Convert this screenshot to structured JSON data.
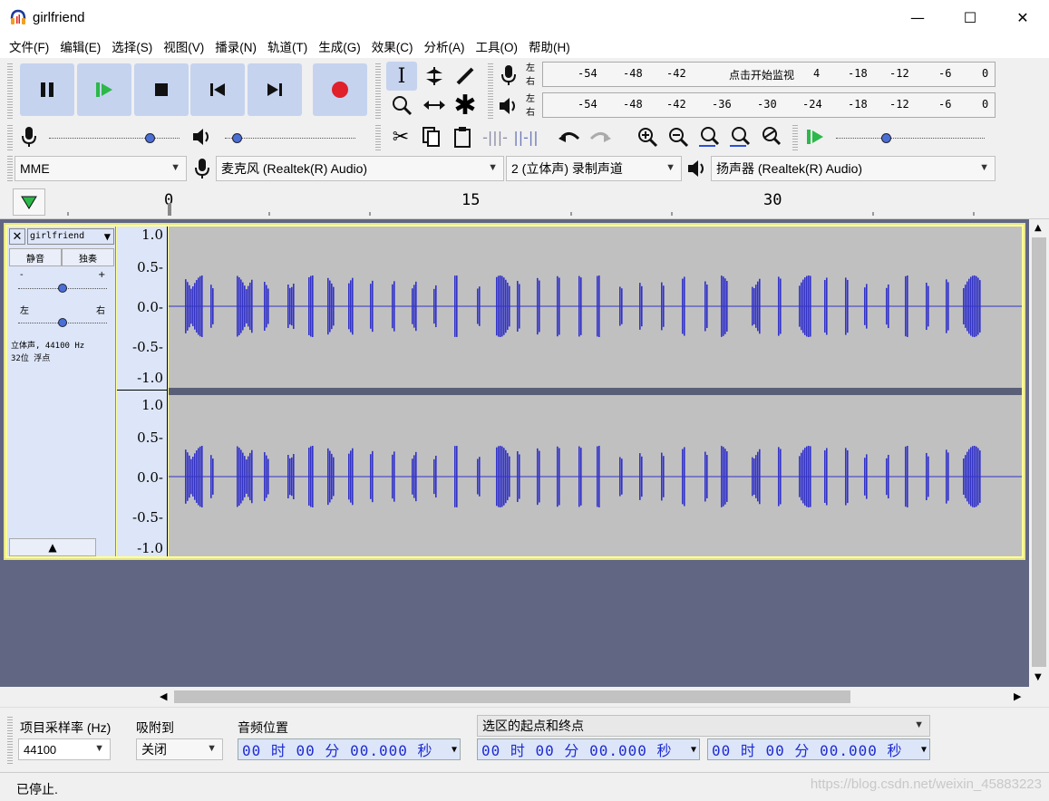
{
  "window": {
    "title": "girlfriend",
    "minimize": "—",
    "maximize": "☐",
    "close": "✕"
  },
  "menu": [
    "文件(F)",
    "编辑(E)",
    "选择(S)",
    "视图(V)",
    "播录(N)",
    "轨道(T)",
    "生成(G)",
    "效果(C)",
    "分析(A)",
    "工具(O)",
    "帮助(H)"
  ],
  "meters": {
    "left_right": [
      "左",
      "右"
    ],
    "record_scale": [
      "-54",
      "-48",
      "-42",
      "点击开始监视",
      "4",
      "-18",
      "-12",
      "-6",
      "0"
    ],
    "play_scale": [
      "-54",
      "-48",
      "-42",
      "-36",
      "-30",
      "-24",
      "-18",
      "-12",
      "-6",
      "0"
    ]
  },
  "devices": {
    "host": "MME",
    "input": "麦克风 (Realtek(R) Audio)",
    "channels": "2 (立体声) 录制声道",
    "output": "扬声器 (Realtek(R) Audio)"
  },
  "ruler": {
    "labels": [
      "0",
      "15",
      "30"
    ]
  },
  "track": {
    "name": "girlfriend",
    "mute": "静音",
    "solo": "独奏",
    "gain_minus": "-",
    "gain_plus": "+",
    "pan_left": "左",
    "pan_right": "右",
    "info_line1": "立体声, 44100 Hz",
    "info_line2": "32位 浮点",
    "vruler_top": [
      "1.0",
      "0.5-",
      "0.0-",
      "-0.5-",
      "-1.0"
    ],
    "vruler_bottom": [
      "1.0",
      "0.5-",
      "0.0-",
      "-0.5-",
      "-1.0"
    ]
  },
  "selection_bar": {
    "rate_label": "项目采样率 (Hz)",
    "rate_value": "44100",
    "snap_label": "吸附到",
    "snap_value": "关闭",
    "pos_label": "音频位置",
    "pos_value": "00 时 00 分 00.000 秒",
    "sel_label": "选区的起点和终点",
    "sel_start": "00 时 00 分 00.000 秒",
    "sel_end": "00 时 00 分 00.000 秒"
  },
  "status": {
    "text": "已停止.",
    "watermark": "https://blog.csdn.net/weixin_45883223"
  },
  "colors": {
    "accent_blue": "#3232c8",
    "record_red": "#e0202a",
    "play_green": "#2cb84a",
    "toolbar_btn": "#c5d3ef",
    "track_bg": "#616683"
  }
}
